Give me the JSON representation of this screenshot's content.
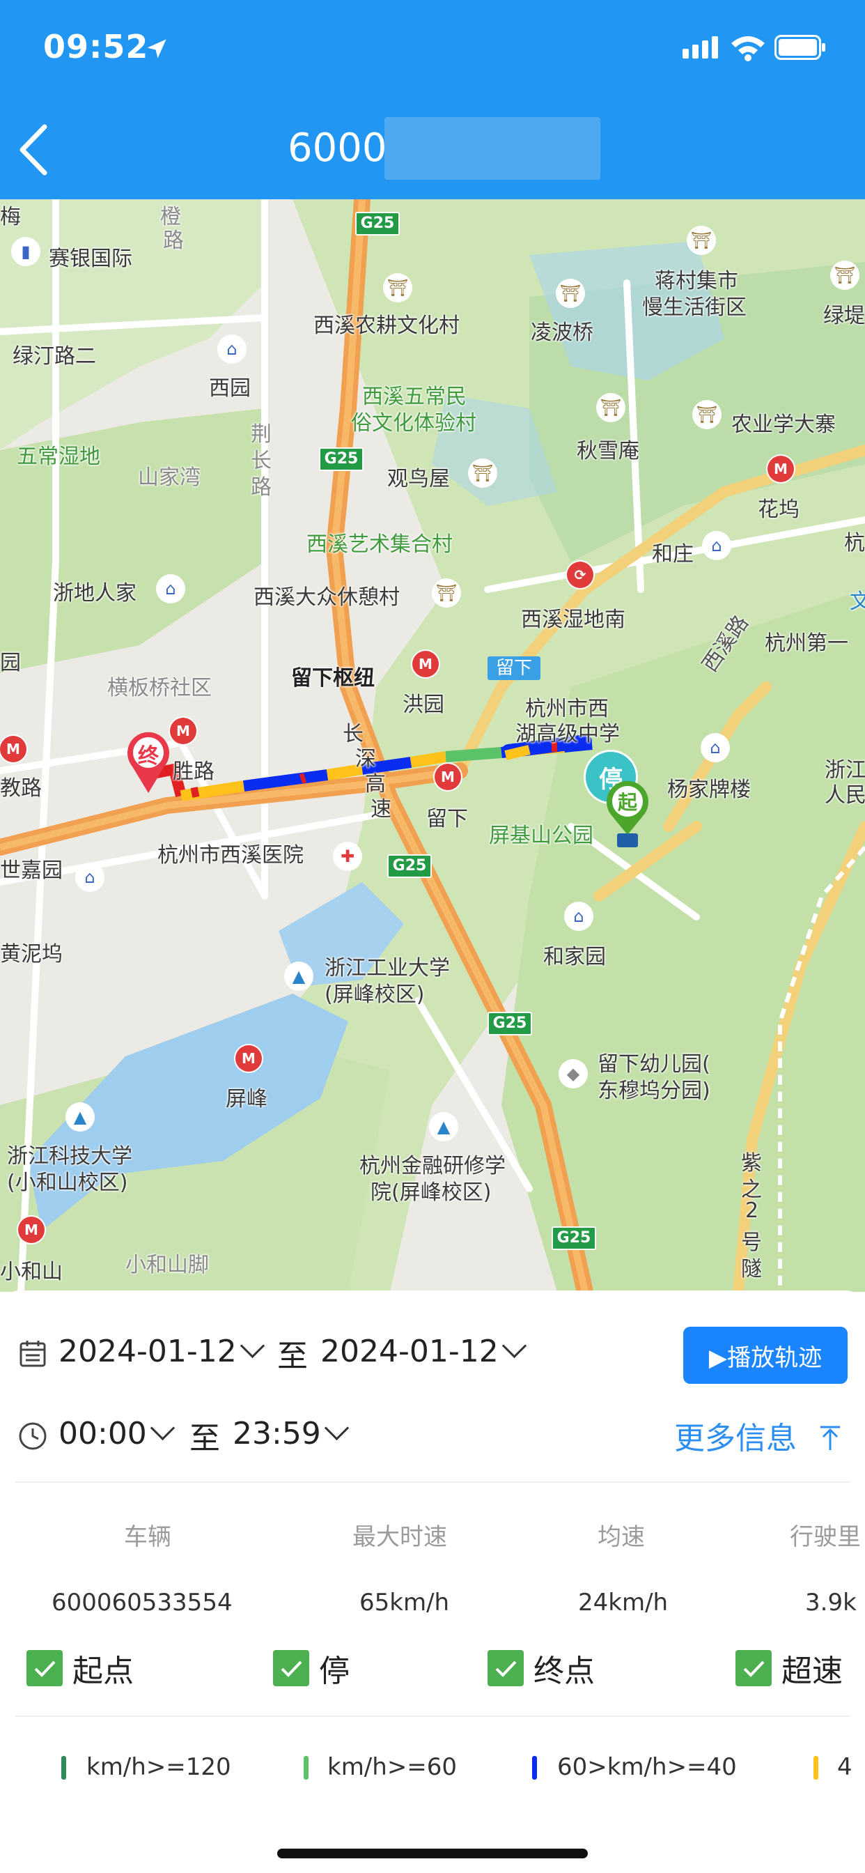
{
  "status_bar": {
    "time": "09:52"
  },
  "header": {
    "title": "6000",
    "back_icon": "chevron-left-icon"
  },
  "map": {
    "road_signs": [
      "G25",
      "G25",
      "G25",
      "G25",
      "G25"
    ],
    "labels": {
      "saiyin": "赛银国际",
      "lvting": "绿汀路二",
      "xiyuan": "西园",
      "wuchang": "五常湿地",
      "shanjiawan": "山家湾",
      "zhedi": "浙地人家",
      "hengban": "横板桥社区",
      "jiaolu": "教路",
      "shijiayuan": "世嘉园",
      "huangniwu": "黄泥坞",
      "zhongsheng": "胜路",
      "xixi_hosp": "杭州市西溪医院",
      "xixi_farm": "西溪农耕文化村",
      "lingbo": "凌波桥",
      "wuchangmin_1": "西溪五常民",
      "wuchangmin_2": "俗文化体验村",
      "guanniao": "观鸟屋",
      "qiuxue": "秋雪庵",
      "art": "西溪艺术集合村",
      "dazhong": "西溪大众休憩村",
      "wetland_s": "西溪湿地南",
      "liuxia_hub": "留下枢纽",
      "hongyuan": "洪园",
      "liuxia_tag": "留下",
      "liuxia": "留下",
      "changshen_1": "长",
      "changshen_2": "深",
      "changshen_3": "高",
      "changshen_4": "速",
      "xihu_school_1": "杭州市西",
      "xihu_school_2": "湖高级中学",
      "pingji": "屏基山公园",
      "yangjia": "杨家牌楼",
      "hejia": "和家园",
      "jiangcun_1": "蒋村集市",
      "jiangcun_2": "慢生活街区",
      "nongye": "农业学大寨",
      "huawu": "花坞",
      "hezhuang": "和庄",
      "hz_first": "杭州第一",
      "zj_people_1": "浙江",
      "zj_people_2": "人民",
      "lvdi": "绿堤",
      "hang": "杭",
      "zjut_1": "浙江工业大学",
      "zjut_2": "(屏峰校区)",
      "pingfeng": "屏峰",
      "kindergarten_1": "留下幼儿园(",
      "kindergarten_2": "东穆坞分园)",
      "zust_1": "浙江科技大学",
      "zust_2": "(小和山校区)",
      "finance_1": "杭州金融研修学",
      "finance_2": "院(屏峰校区)",
      "xiaoheshan": "小和山",
      "xiaoheshanjiao": "小和山脚",
      "zizhi_1": "紫",
      "zizhi_2": "之",
      "zizhi_3": "2",
      "zizhi_4": "号",
      "zizhi_5": "隧",
      "jiangkou": "荆",
      "jiangkou2": "长",
      "jiangkou3": "路",
      "xixi_road": "西溪路",
      "chengqiao_1": "橙",
      "chengqiao_2": "路",
      "mei": "梅",
      "yuan": "园",
      "wen": "文"
    },
    "markers": {
      "start": "起",
      "stop": "停",
      "end": "终"
    }
  },
  "filters": {
    "date_start": "2024-01-12",
    "date_end": "2024-01-12",
    "date_sep": "至",
    "time_start": "00:00",
    "time_end": "23:59",
    "time_sep": "至",
    "play_label": "▶播放轨迹",
    "more_info": "更多信息"
  },
  "stats": {
    "headers": [
      "车辆",
      "最大时速",
      "均速",
      "行驶里"
    ],
    "values": [
      "600060533554",
      "65km/h",
      "24km/h",
      "3.9k"
    ]
  },
  "toggles": [
    {
      "label": "起点",
      "checked": true
    },
    {
      "label": "停",
      "checked": true
    },
    {
      "label": "终点",
      "checked": true
    },
    {
      "label": "超速",
      "checked": true
    }
  ],
  "legend": [
    {
      "label": "km/h>=120",
      "color": "#2e8b57"
    },
    {
      "label": "km/h>=60",
      "color": "#5cc26a"
    },
    {
      "label": "60>km/h>=40",
      "color": "#0a2cf0"
    },
    {
      "label": "4",
      "color": "#ffc21a"
    }
  ],
  "colors": {
    "header_bg": "#2196f3",
    "accent": "#1a85ff",
    "check": "#4caf50"
  }
}
